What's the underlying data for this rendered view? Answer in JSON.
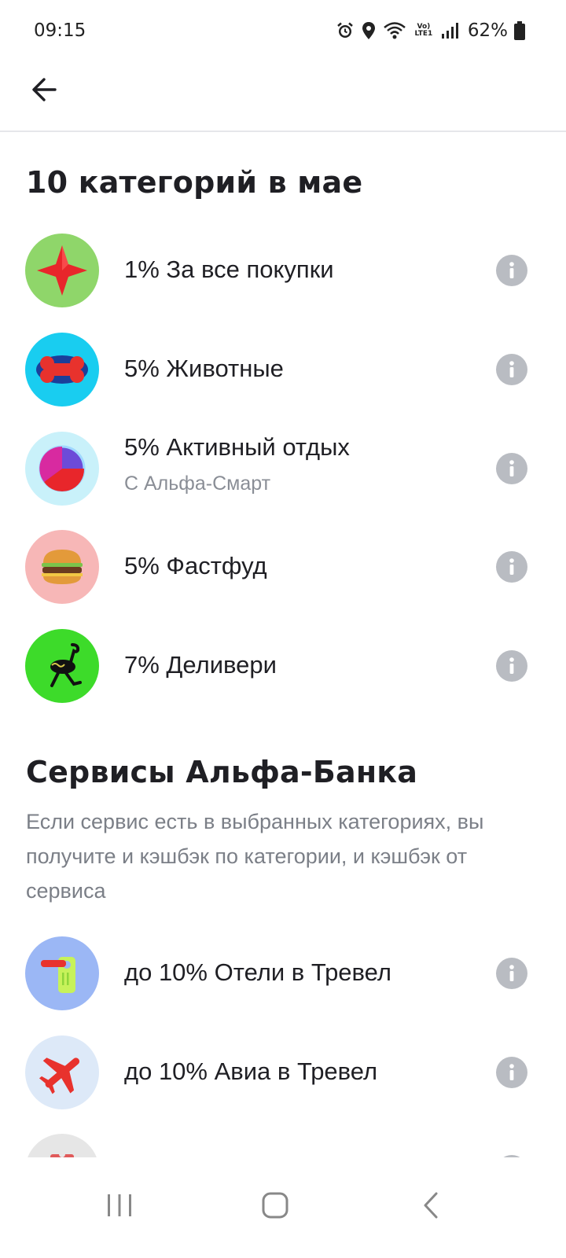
{
  "status_bar": {
    "time": "09:15",
    "network_label": "Vo) LTE1",
    "battery": "62%",
    "icons": [
      "alarm-icon",
      "location-icon",
      "wifi-icon",
      "volte-icon",
      "signal-icon",
      "battery-icon"
    ]
  },
  "top_bar": {
    "back_icon": "arrow-left-icon"
  },
  "categories": {
    "title": "10 категорий в мае",
    "items": [
      {
        "label": "1% За все покупки",
        "icon": "red-star-icon",
        "badge_color": "#8fd66a"
      },
      {
        "label": "5% Животные",
        "icon": "bone-icon",
        "badge_color": "#19cdf0"
      },
      {
        "label": "5% Активный отдых",
        "sublabel": "С Альфа-Смарт",
        "icon": "alfa-smart-icon",
        "badge_color": "#c9f1fa"
      },
      {
        "label": "5% Фастфуд",
        "icon": "burger-icon",
        "badge_color": "#f7b7b7"
      },
      {
        "label": "7% Деливери",
        "icon": "ostrich-icon",
        "badge_color": "#3ddb2a"
      }
    ]
  },
  "services": {
    "title": "Сервисы Альфа-Банка",
    "description": "Если сервис есть в выбранных категориях, вы получите и кэшбэк по категории, и кэшбэк от сервиса",
    "items": [
      {
        "label": "до 10% Отели в Тревел",
        "icon": "door-hanger-icon",
        "badge_color": "#9bb7f5"
      },
      {
        "label": "до 10% Авиа в Тревел",
        "icon": "airplane-icon",
        "badge_color": "#dde9f8"
      },
      {
        "label": "",
        "icon": "ticket-icon",
        "badge_color": "#e6e6e6"
      }
    ]
  },
  "nav_bar": {
    "icons": [
      "recent-apps-icon",
      "home-icon",
      "back-icon"
    ]
  },
  "colors": {
    "info_icon": "#b9bcc2",
    "title_text": "#1f1f24",
    "secondary_text": "#7b7f87"
  }
}
